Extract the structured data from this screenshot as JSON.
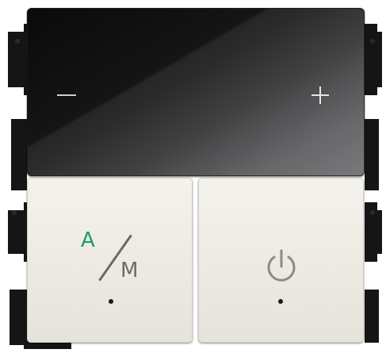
{
  "device": {
    "glass_panel": {
      "minus_symbol": "−",
      "plus_symbol": "+"
    },
    "buttons": {
      "mode_button": {
        "letter_a": "A",
        "letter_m": "M",
        "a_color": "#1f9a63",
        "m_color": "#6a6a6a"
      },
      "power_button": {
        "icon": "power-icon"
      }
    },
    "colors": {
      "glass": "#0a0a0a",
      "button_face": "#f0eee8",
      "frame": "#141414"
    }
  }
}
